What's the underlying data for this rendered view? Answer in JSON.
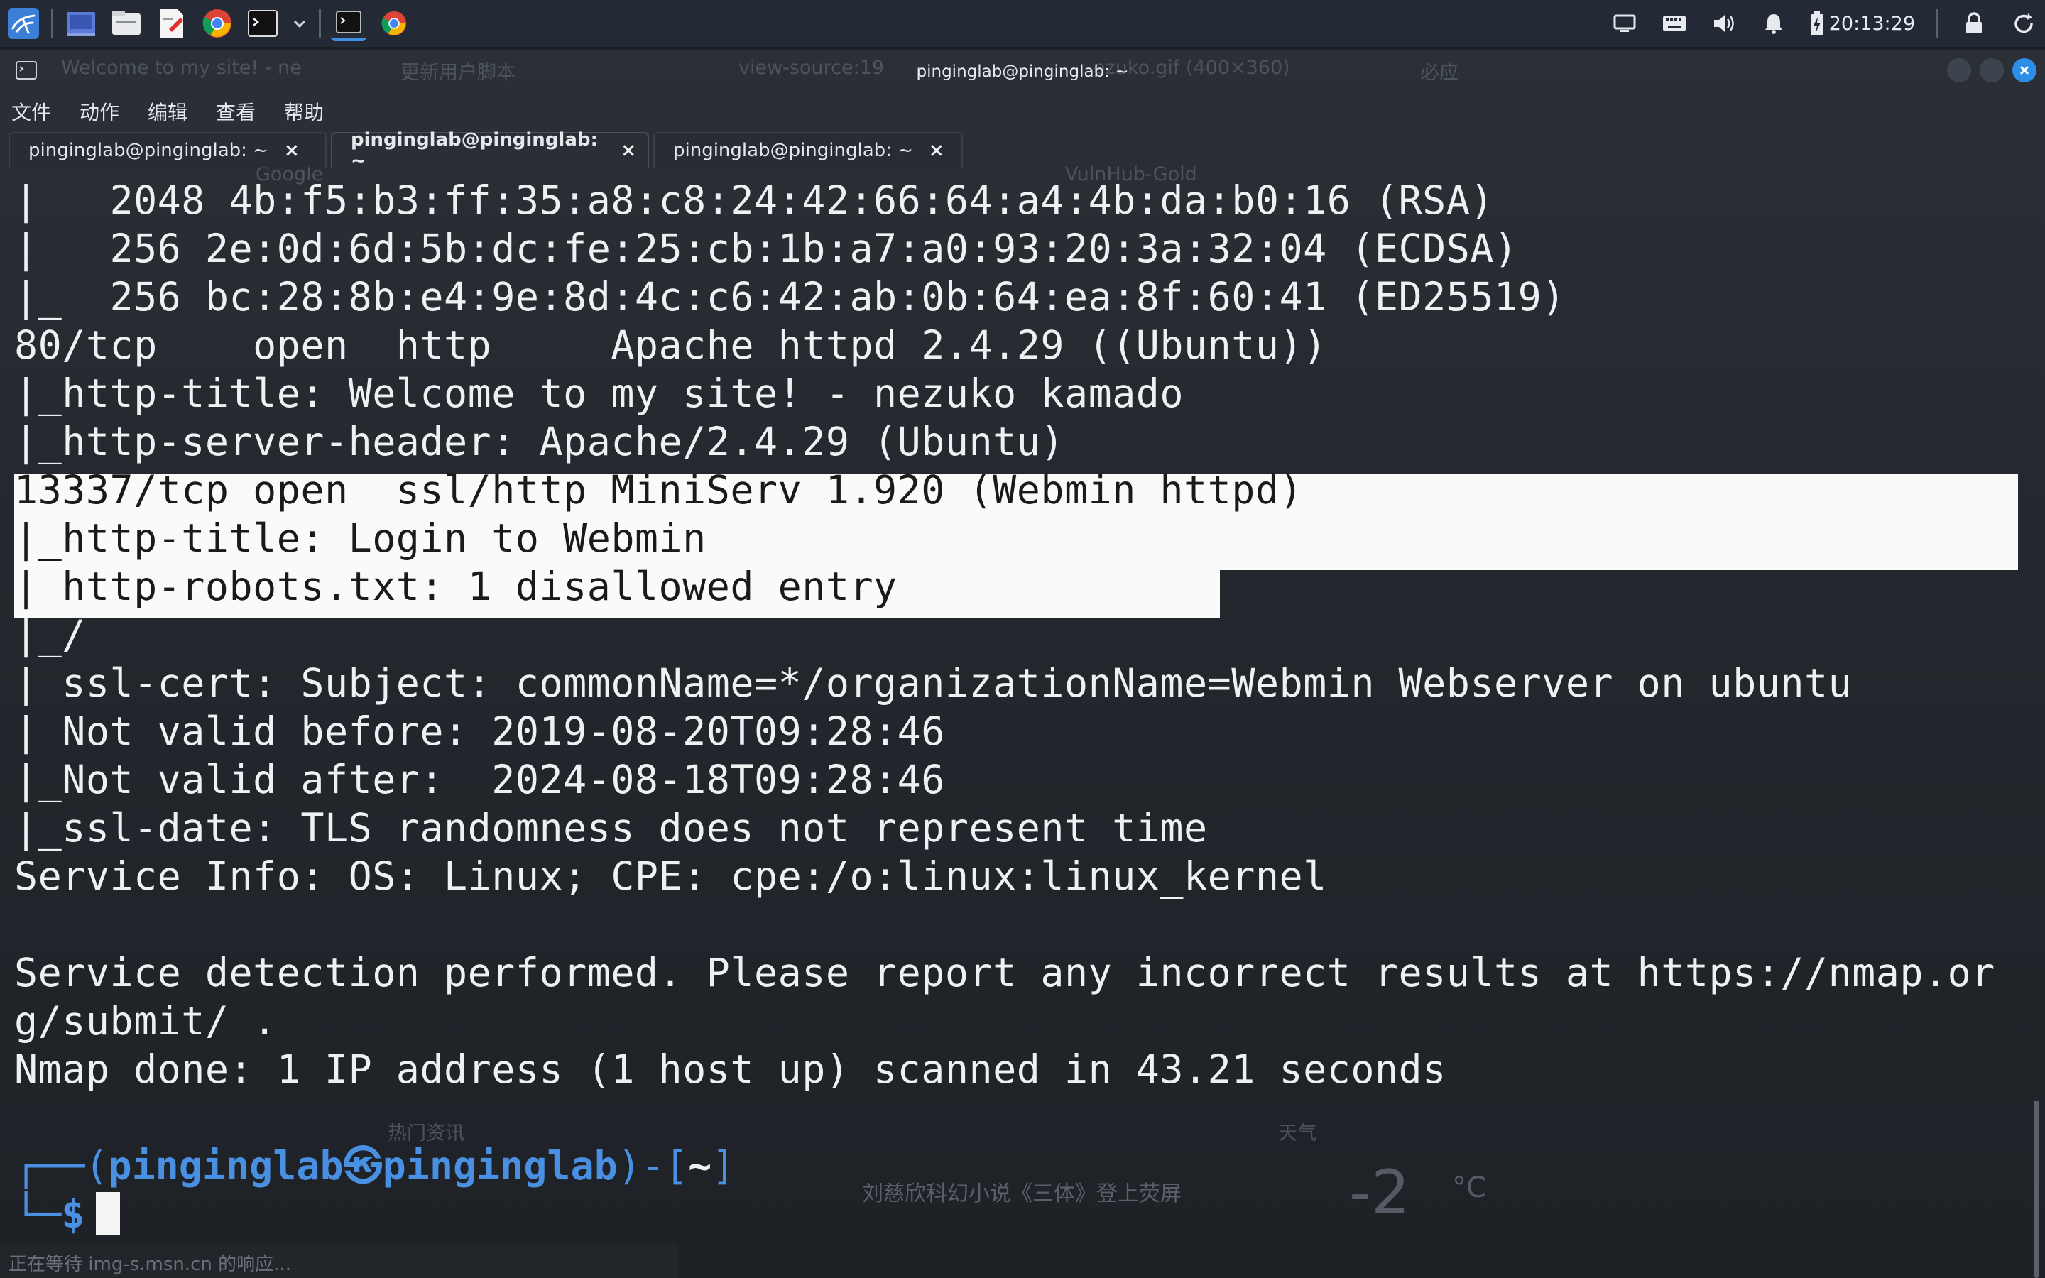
{
  "taskbar": {
    "clock": "20:13:29",
    "left_icons": [
      "kali-menu-icon",
      "desktop-icon",
      "file-manager-icon",
      "text-editor-icon",
      "chrome-icon",
      "terminal-icon",
      "chevron-down-icon",
      "terminal-window-icon",
      "chrome-window-icon"
    ],
    "right_icons": [
      "display-icon",
      "keyboard-icon",
      "volume-icon",
      "bell-icon",
      "battery-icon",
      "lock-icon",
      "power-icon"
    ]
  },
  "window": {
    "title": "pinginglab@pinginglab: ~",
    "menu": [
      "文件",
      "动作",
      "编辑",
      "查看",
      "帮助"
    ],
    "tabs": [
      {
        "label": "pinginglab@pinginglab: ~",
        "active": false
      },
      {
        "label": "pinginglab@pinginglab: ~",
        "active": true
      },
      {
        "label": "pinginglab@pinginglab: ~",
        "active": false
      }
    ],
    "tab_close": "×"
  },
  "background_ghost": {
    "browser_tab_1": "Welcome to my site! - ne",
    "browser_tab_2": "更新用户脚本",
    "browser_tab_3": "view-source:19",
    "browser_tab_4": "ezuko.gif (400×360)",
    "browser_tab_5": "必应",
    "bookmark_1": "Google",
    "bookmark_2": "VulnHub-Gold",
    "status": "正在等待 img-s.msn.cn 的响应...",
    "news_title": "热门资讯",
    "news_item": "刘慈欣科幻小说《三体》登上荧屏",
    "weather_title": "天气",
    "weather_temp": "-2",
    "weather_unit": "°C"
  },
  "terminal": {
    "lines": [
      "|   2048 4b:f5:b3:ff:35:a8:c8:24:42:66:64:a4:4b:da:b0:16 (RSA)",
      "|   256 2e:0d:6d:5b:dc:fe:25:cb:1b:a7:a0:93:20:3a:32:04 (ECDSA)",
      "|_  256 bc:28:8b:e4:9e:8d:4c:c6:42:ab:0b:64:ea:8f:60:41 (ED25519)",
      "80/tcp    open  http     Apache httpd 2.4.29 ((Ubuntu))",
      "|_http-title: Welcome to my site! - nezuko kamado",
      "|_http-server-header: Apache/2.4.29 (Ubuntu)",
      "13337/tcp open  ssl/http MiniServ 1.920 (Webmin httpd)",
      "|_http-title: Login to Webmin",
      "| http-robots.txt: 1 disallowed entry",
      "|_/",
      "| ssl-cert: Subject: commonName=*/organizationName=Webmin Webserver on ubuntu",
      "| Not valid before: 2019-08-20T09:28:46",
      "|_Not valid after:  2024-08-18T09:28:46",
      "|_ssl-date: TLS randomness does not represent time",
      "Service Info: OS: Linux; CPE: cpe:/o:linux:linux_kernel",
      "",
      "Service detection performed. Please report any incorrect results at https://nmap.or",
      "g/submit/ .",
      "Nmap done: 1 IP address (1 host up) scanned in 43.21 seconds",
      ""
    ],
    "prompt": {
      "corner_top": "┌──(",
      "user": "pinginglab",
      "at": "㉿",
      "host": "pinginglab",
      "mid": ")-[",
      "cwd": "~",
      "end": "]",
      "corner_bottom": "└─",
      "symbol": "$"
    }
  }
}
